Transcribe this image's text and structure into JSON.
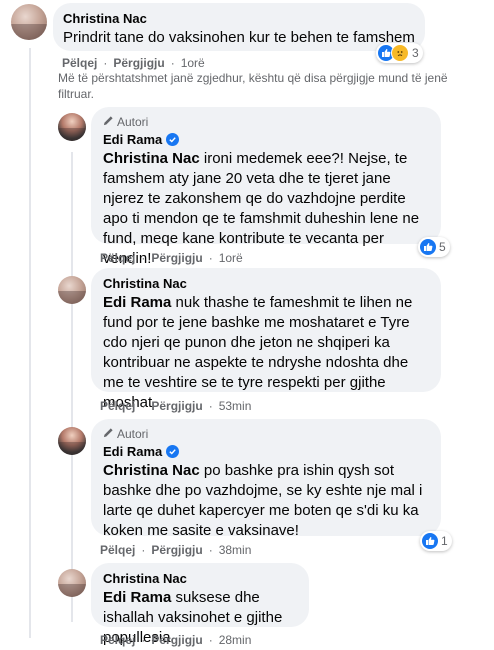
{
  "comments": [
    {
      "author": "Christina Nac",
      "text": "Prindrit tane do vaksinohen kur te behen te famshem",
      "actions": {
        "like": "Pëlqej",
        "reply": "Përgjigju",
        "time": "1orë"
      },
      "reactions": {
        "icons": [
          "like-icon",
          "sad-icon"
        ],
        "count": "3"
      }
    }
  ],
  "filter_note": "Më të përshtatshmet janë zgjedhur, kështu që disa përgjigje mund të jenë filtruar.",
  "replies": [
    {
      "author_badge": "Autori",
      "author": "Edi Rama",
      "verified": true,
      "mention": "Christina Nac",
      "text": " ironi medemek eee?! Nejse, te famshem aty jane 20 veta dhe te tjeret jane njerez te zakonshem qe do vazhdojne perdite apo ti mendon qe te famshmit duheshin lene ne fund, meqe kane kontribute te vecanta per vendin!",
      "actions": {
        "like": "Pëlqej",
        "reply": "Përgjigju",
        "time": "1orë"
      },
      "reactions": {
        "count": "5"
      }
    },
    {
      "author": "Christina Nac",
      "mention": "Edi Rama",
      "text": " nuk thashe te fameshmit te lihen ne fund por te jene bashke me moshataret e Tyre cdo njeri qe punon dhe jeton ne shqiperi ka kontribuar ne aspekte te ndryshe ndoshta dhe me te veshtire se te tyre respekti per gjithe moshat",
      "actions": {
        "like": "Pëlqej",
        "reply": "Përgjigju",
        "time": "53min"
      }
    },
    {
      "author_badge": "Autori",
      "author": "Edi Rama",
      "verified": true,
      "mention": "Christina Nac",
      "text": " po bashke pra ishin qysh sot bashke dhe po vazhdojme, se ky eshte nje mal i larte qe duhet kapercyer me boten qe s'di ku ka koken me sasite e vaksinave!",
      "actions": {
        "like": "Pëlqej",
        "reply": "Përgjigju",
        "time": "38min"
      },
      "reactions": {
        "count": "1"
      }
    },
    {
      "author": "Christina Nac",
      "mention": "Edi Rama",
      "text": " suksese dhe ishallah vaksinohet e gjithe popullesia",
      "actions": {
        "like": "Pëlqej",
        "reply": "Përgjigju",
        "time": "28min"
      }
    }
  ]
}
